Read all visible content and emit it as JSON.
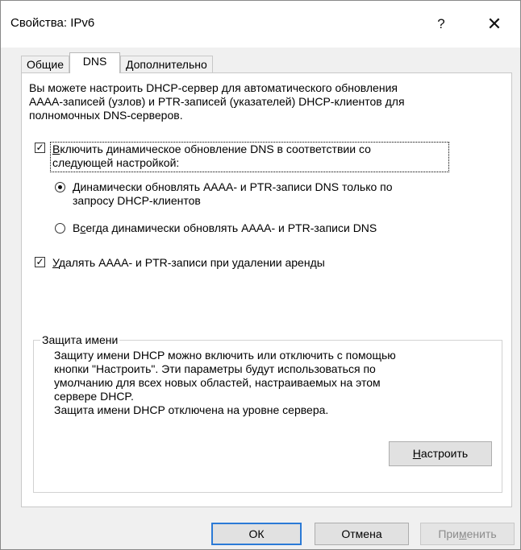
{
  "window": {
    "title": "Свойства: IPv6",
    "help": "?",
    "close": "✕"
  },
  "tabs": [
    {
      "label": "Общие"
    },
    {
      "label": "DNS"
    },
    {
      "label": "Дополнительно"
    }
  ],
  "dns": {
    "intro": [
      "Вы можете настроить DHCP-сервер для автоматического обновления",
      "AAAA-записей (узлов) и PTR-записей (указателей) DHCP-клиентов для",
      "полномочных DNS-серверов."
    ],
    "enable_dynamic_update": {
      "checked": true,
      "line1_prefix": "В",
      "line1_rest": "ключить динамическое обновление DNS в соответствии со",
      "line2": "следующей настройкой:"
    },
    "option_on_request": {
      "selected": true,
      "line1_prefix": "Д",
      "line1_rest": "инамически обновлять AAAA- и PTR-записи DNS только по",
      "line2": "запросу DHCP-клиентов"
    },
    "option_always": {
      "selected": false,
      "prefix": "В",
      "underlined": "с",
      "rest": "егда динамически обновлять AAAA- и PTR-записи DNS"
    },
    "delete_on_lease_expiry": {
      "checked": true,
      "prefix": "У",
      "rest": "далять AAAA- и PTR-записи при удалении аренды"
    },
    "name_protection": {
      "title": "Защита имени",
      "lines": [
        "Защиту имени DHCP можно включить или отключить с помощью",
        "кнопки \"Настроить\". Эти параметры будут использоваться по",
        "умолчанию для всех новых областей, настраиваемых на этом",
        "сервере DHCP.",
        "Защита имени DHCP отключена на уровне сервера."
      ],
      "configure_button": {
        "prefix": "Н",
        "rest": "астроить"
      }
    }
  },
  "footer": {
    "ok": "ОК",
    "cancel": "Отмена",
    "apply_prefix": "При",
    "apply_underlined": "м",
    "apply_rest": "енить"
  }
}
